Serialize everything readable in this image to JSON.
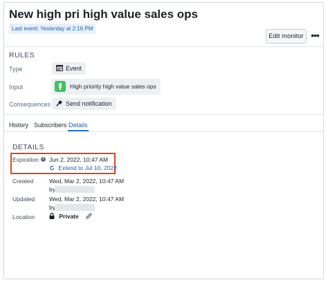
{
  "header": {
    "title": "New high pri high value sales ops",
    "last_event": "Last event: Yesterday at 2:16 PM",
    "edit_label": "Edit monitor",
    "more_label": "•••"
  },
  "rules": {
    "heading": "RULES",
    "type_label": "Type",
    "type_value": "Event",
    "type_icon": "calendar-icon",
    "input_label": "Input",
    "input_value": "High priority high value sales ops",
    "input_icon": "object-icon",
    "consequences_label": "Consequences",
    "consequences_value": "Send notification",
    "consequences_icon": "notification-icon"
  },
  "tabs": [
    {
      "label": "History",
      "active": false
    },
    {
      "label": "Subscribers",
      "active": false
    },
    {
      "label": "Details",
      "active": true
    }
  ],
  "details": {
    "heading": "DETAILS",
    "expiration_label": "Expiration",
    "expiration_value": "Jun 2, 2022, 10:47 AM",
    "extend_label": "Extend to Jul 10, 2022",
    "created_label": "Created",
    "created_value": "Wed, Mar 2, 2022, 10:47 AM",
    "created_by": "by",
    "updated_label": "Updated",
    "updated_value": "Wed, Mar 2, 2022, 10:47 AM",
    "updated_by": "by",
    "location_label": "Location",
    "location_value": "Private"
  },
  "colors": {
    "accent": "#215db0",
    "highlight_border": "#e0431a",
    "input_icon": "#3ec35e"
  }
}
